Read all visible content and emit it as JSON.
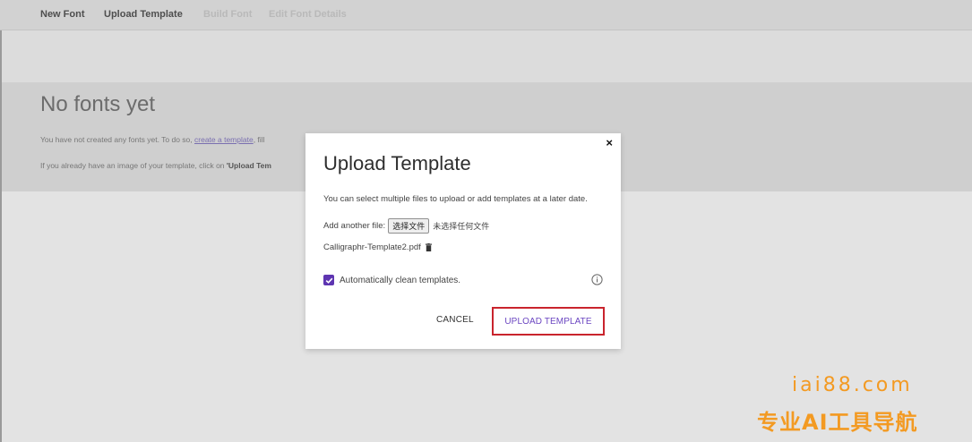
{
  "nav": {
    "items": [
      {
        "label": "New Font"
      },
      {
        "label": "Upload Template"
      },
      {
        "label": "Build Font"
      },
      {
        "label": "Edit Font Details"
      }
    ]
  },
  "page": {
    "title": "No fonts yet",
    "line1_prefix": "You have not created any fonts yet. To do so, ",
    "line1_link": "create a template",
    "line1_suffix": ", fill",
    "line2_prefix": "If you already have an image of your template, click on ",
    "line2_bold": "'Upload Tem"
  },
  "modal": {
    "close_label": "×",
    "title": "Upload Template",
    "description": "You can select multiple files to upload or add templates at a later date.",
    "add_file_label": "Add another file:",
    "choose_file_button": "选择文件",
    "file_status": "未选择任何文件",
    "uploaded_file": "Calligraphr-Template2.pdf",
    "auto_clean_label": "Automatically clean templates.",
    "auto_clean_checked": true,
    "cancel_label": "CANCEL",
    "upload_label": "UPLOAD TEMPLATE"
  },
  "watermark": {
    "line1": "iai88.com",
    "line2": "专业AI工具导航"
  },
  "colors": {
    "accent": "#5e35b1",
    "upload_text": "#6b46c1",
    "highlight_border": "#c9242d",
    "watermark": "#f39a22"
  },
  "icons": [
    "close-icon",
    "trash-icon",
    "checkbox-check-icon",
    "info-icon"
  ]
}
